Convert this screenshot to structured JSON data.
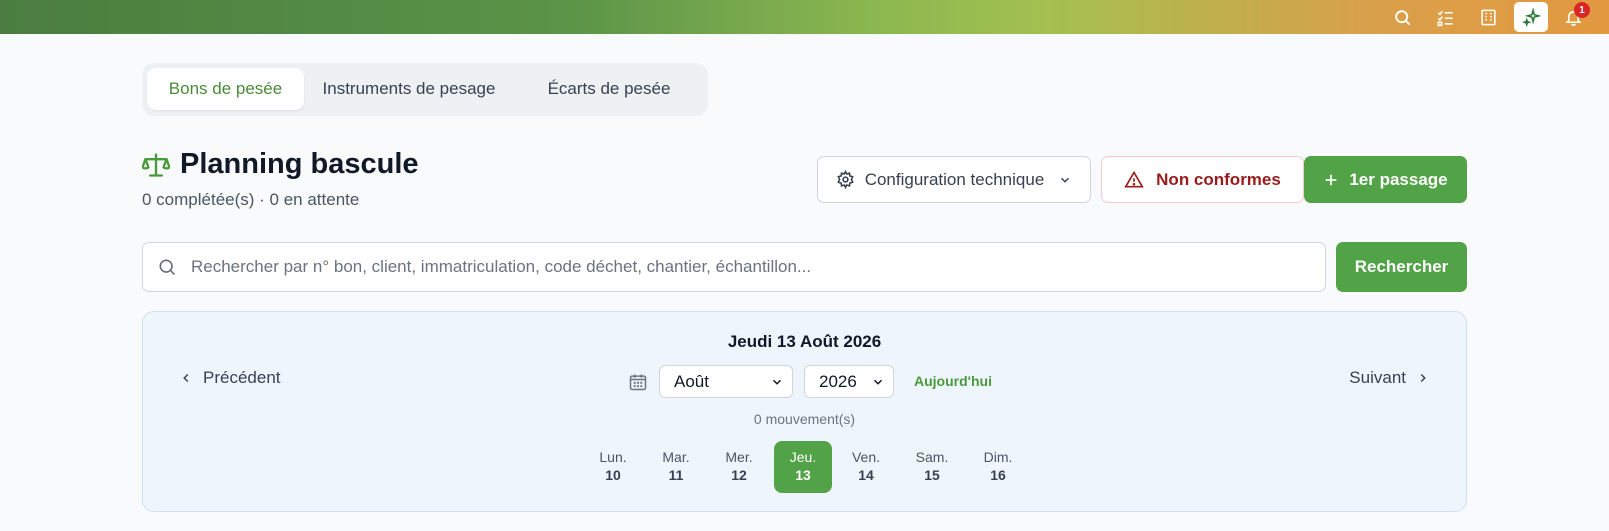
{
  "topbar": {
    "icons": [
      "search-icon",
      "checklist-icon",
      "building-icon",
      "sparkles-icon",
      "bell-icon"
    ],
    "notification_count": "1"
  },
  "tabs": [
    {
      "label": "Bons de pesée"
    },
    {
      "label": "Instruments de pesage"
    },
    {
      "label": "Écarts de pesée"
    }
  ],
  "header": {
    "icon": "scale-icon",
    "title": "Planning bascule",
    "subtitle": "0 complétée(s) · 0 en attente"
  },
  "actions": {
    "config_label": "Configuration technique",
    "nonconf_label": "Non conformes",
    "pass_label": "1er passage"
  },
  "search": {
    "placeholder": "Rechercher par n° bon, client, immatriculation, code déchet, chantier, échantillon...",
    "button_label": "Rechercher"
  },
  "calendar": {
    "date_title": "Jeudi 13 Août 2026",
    "prev_label": "Précédent",
    "next_label": "Suivant",
    "month_selected": "Août",
    "year_selected": "2026",
    "today_label": "Aujourd'hui",
    "movements": "0 mouvement(s)",
    "days": [
      {
        "name": "Lun.",
        "num": "10"
      },
      {
        "name": "Mar.",
        "num": "11"
      },
      {
        "name": "Mer.",
        "num": "12"
      },
      {
        "name": "Jeu.",
        "num": "13"
      },
      {
        "name": "Ven.",
        "num": "14"
      },
      {
        "name": "Sam.",
        "num": "15"
      },
      {
        "name": "Dim.",
        "num": "16"
      }
    ],
    "active_day_index": 3
  },
  "colors": {
    "accent": "#52a347",
    "danger": "#991b1b",
    "badge": "#dc2626"
  }
}
